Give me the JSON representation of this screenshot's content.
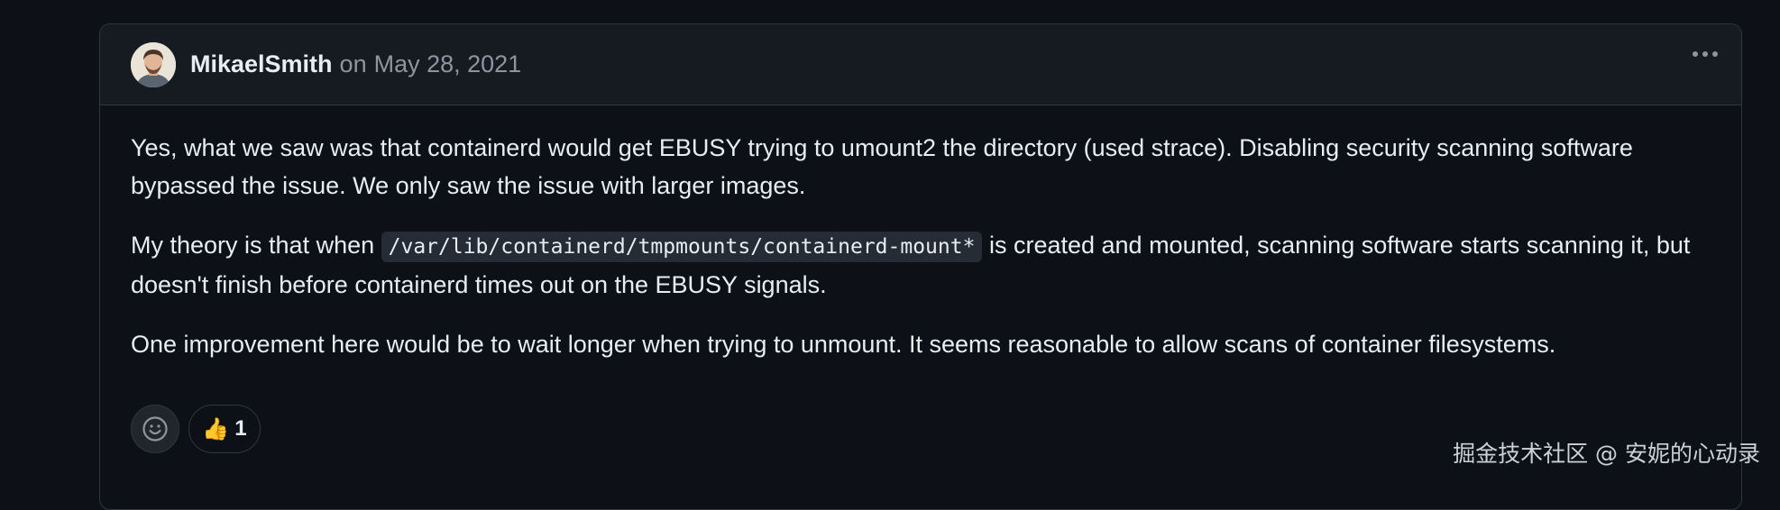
{
  "comment": {
    "author": "MikaelSmith",
    "on_text": "on",
    "date": "May 28, 2021",
    "paragraphs": [
      {
        "text": "Yes, what we saw was that containerd would get EBUSY trying to umount2 the directory (used strace). Disabling security scanning software bypassed the issue. We only saw the issue with larger images."
      },
      {
        "before": "My theory is that when ",
        "code": "/var/lib/containerd/tmpmounts/containerd-mount*",
        "after": " is created and mounted, scanning software starts scanning it, but doesn't finish before containerd times out on the EBUSY signals."
      },
      {
        "text": "One improvement here would be to wait longer when trying to unmount. It seems reasonable to allow scans of container filesystems."
      }
    ],
    "reactions": {
      "thumbs_up_emoji": "👍",
      "thumbs_up_count": "1"
    }
  },
  "watermark": "掘金技术社区 @ 安妮的心动录",
  "colors": {
    "background": "#0d1117",
    "header_bg": "#161b22",
    "border": "#30363d",
    "text": "#e6edf3",
    "muted": "#8d96a0"
  },
  "icons": [
    "avatar-image",
    "kebab-menu-icon",
    "smiley-icon"
  ]
}
